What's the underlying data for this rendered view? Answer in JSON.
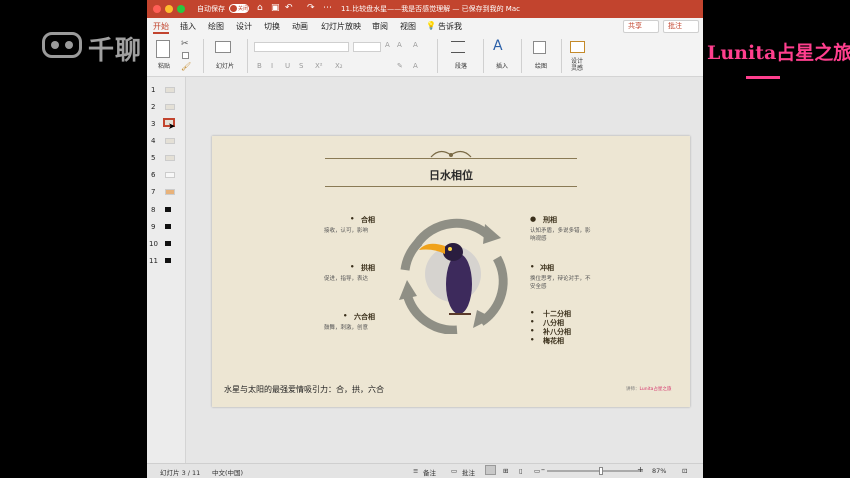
{
  "watermark": {
    "text": "千聊"
  },
  "brand": {
    "text": "Lunita占星之旅",
    "color": "#ff3f8e"
  },
  "window": {
    "autosave_label": "自动保存",
    "autosave_state": "关闭",
    "title": "11.比较盘水星——我是否感觉理解 — 已保存到我的 Mac",
    "accent_color": "#c2442e"
  },
  "tabs": [
    "开始",
    "插入",
    "绘图",
    "设计",
    "切换",
    "动画",
    "幻灯片放映",
    "审阅",
    "视图",
    "告诉我"
  ],
  "share_label": "共享",
  "comment_label": "批注",
  "ribbon": {
    "paste": "粘贴",
    "slide": "幻灯片",
    "format_buttons": [
      "B",
      "I",
      "U",
      "S",
      "X²",
      "X₂"
    ],
    "paragraph": "段落",
    "insert": "插入",
    "draw": "绘图",
    "designer": "设计\n灵感"
  },
  "thumbnails": [
    "1",
    "2",
    "3",
    "4",
    "5",
    "6",
    "7",
    "8",
    "9",
    "10",
    "11"
  ],
  "slide": {
    "title": "日水相位",
    "left_items": [
      {
        "head": "合相",
        "body": "接收，认可，影响"
      },
      {
        "head": "拱相",
        "body": "促进，指导，表达"
      },
      {
        "head": "六合相",
        "body": "鼓舞，刺激，创意"
      }
    ],
    "right_items": [
      {
        "head": "刑相",
        "body": [
          "认知矛盾，多说多错，影",
          "响观感"
        ]
      },
      {
        "head": "冲相",
        "body": [
          "换位思考，辩论对手，不",
          "安全感"
        ]
      }
    ],
    "minor_aspects": [
      "十二分相",
      "八分相",
      "补八分相",
      "梅花相"
    ],
    "footer": "水星与太阳的最强爱情吸引力：合，拱，六合",
    "credit_prefix": "讲师：",
    "credit_name": "Lunita占星之旅"
  },
  "status": {
    "slide_info": "幻灯片 3 / 11",
    "language": "中文(中国)",
    "notes": "备注",
    "comments": "批注",
    "zoom": "87%"
  }
}
